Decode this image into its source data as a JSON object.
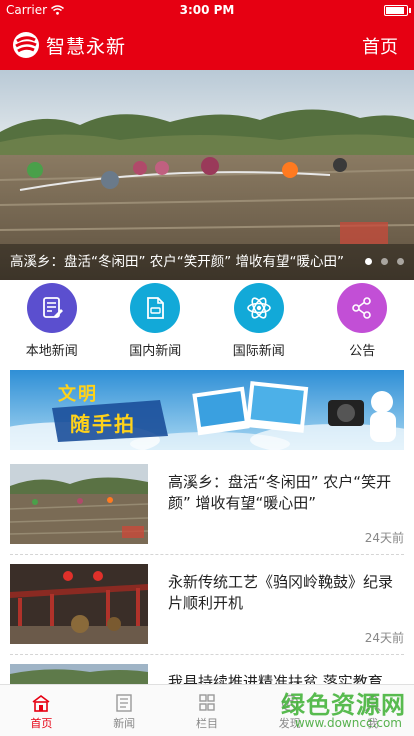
{
  "status_bar": {
    "carrier": "Carrier",
    "time": "3:00 PM"
  },
  "header": {
    "title": "智慧永新",
    "home_link": "首页"
  },
  "banner": {
    "caption": "高溪乡：盘活“冬闲田” 农户“笑开颜” 增收有望“暖心田”",
    "slide_count": 3,
    "active_slide": 1
  },
  "categories": [
    {
      "label": "本地新闻",
      "icon": "local-news-icon",
      "color": "#5b4fcf"
    },
    {
      "label": "国内新闻",
      "icon": "national-news-icon",
      "color": "#12a9d8"
    },
    {
      "label": "国际新闻",
      "icon": "atom-icon",
      "color": "#12a9d8"
    },
    {
      "label": "公告",
      "icon": "share-icon",
      "color": "#c24fd6"
    }
  ],
  "ad_banner": {
    "slogan_line1": "文明",
    "slogan_line2": "随手拍"
  },
  "news": [
    {
      "title": "高溪乡：盘活“冬闲田” 农户“笑开颜” 增收有望“暖心田”",
      "time": "24天前"
    },
    {
      "title": "永新传统工艺《驺冈岭鞔鼓》纪录片顺利开机",
      "time": "24天前"
    },
    {
      "title": "我县持续推进精准扶贫 落实教育",
      "time": ""
    }
  ],
  "tabs": [
    {
      "label": "首页",
      "icon": "home-icon",
      "active": true
    },
    {
      "label": "新闻",
      "icon": "news-icon",
      "active": false
    },
    {
      "label": "栏目",
      "icon": "grid-icon",
      "active": false
    },
    {
      "label": "发现",
      "icon": "discover-icon",
      "active": false
    },
    {
      "label": "我",
      "icon": "profile-icon",
      "active": false
    }
  ],
  "watermark": {
    "site_name": "绿色资源网",
    "url": "www.downcc.com"
  },
  "colors": {
    "brand_red": "#e60012",
    "tab_inactive": "#888888",
    "time_gray": "#888888"
  }
}
